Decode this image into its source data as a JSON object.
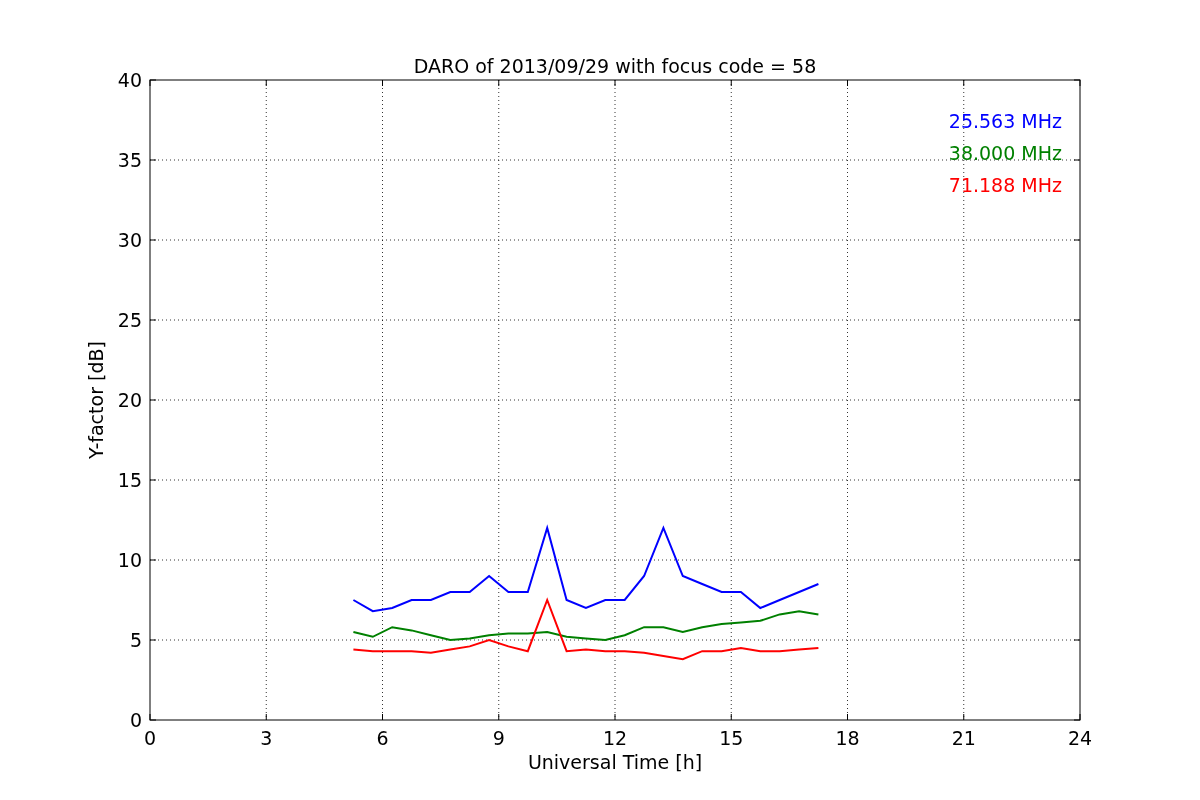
{
  "chart_data": {
    "type": "line",
    "title": "DARO of 2013/09/29 with focus code = 58",
    "xlabel": "Universal Time [h]",
    "ylabel": "Y-factor [dB]",
    "x": [
      5.25,
      5.75,
      6.25,
      6.75,
      7.25,
      7.75,
      8.25,
      8.75,
      9.25,
      9.75,
      10.25,
      10.75,
      11.25,
      11.75,
      12.25,
      12.75,
      13.25,
      13.75,
      14.25,
      14.75,
      15.25,
      15.75,
      16.25,
      16.75,
      17.25
    ],
    "series": [
      {
        "name": "25.563 MHz",
        "color": "#0000ff",
        "values": [
          7.5,
          6.8,
          7,
          7.5,
          7.5,
          8,
          8,
          9,
          8,
          8,
          12,
          7.5,
          7,
          7.5,
          7.5,
          9,
          12,
          9,
          8.5,
          8,
          8,
          7,
          7.5,
          8,
          8.5
        ]
      },
      {
        "name": "38.000 MHz",
        "color": "#008000",
        "values": [
          5.5,
          5.2,
          5.8,
          5.6,
          5.3,
          5,
          5.1,
          5.3,
          5.4,
          5.4,
          5.5,
          5.2,
          5.1,
          5,
          5.3,
          5.8,
          5.8,
          5.5,
          5.8,
          6,
          6.1,
          6.2,
          6.6,
          6.8,
          6.6
        ]
      },
      {
        "name": "71.188 MHz",
        "color": "#ff0000",
        "values": [
          4.4,
          4.3,
          4.3,
          4.3,
          4.2,
          4.4,
          4.6,
          5,
          4.6,
          4.3,
          7.5,
          4.3,
          4.4,
          4.3,
          4.3,
          4.2,
          4,
          3.8,
          4.3,
          4.3,
          4.5,
          4.3,
          4.3,
          4.4,
          4.5
        ]
      }
    ],
    "xlim": [
      0,
      24
    ],
    "ylim": [
      0,
      40
    ],
    "xticks": [
      0,
      3,
      6,
      9,
      12,
      15,
      18,
      21,
      24
    ],
    "yticks": [
      0,
      5,
      10,
      15,
      20,
      25,
      30,
      35,
      40
    ],
    "grid": true
  }
}
